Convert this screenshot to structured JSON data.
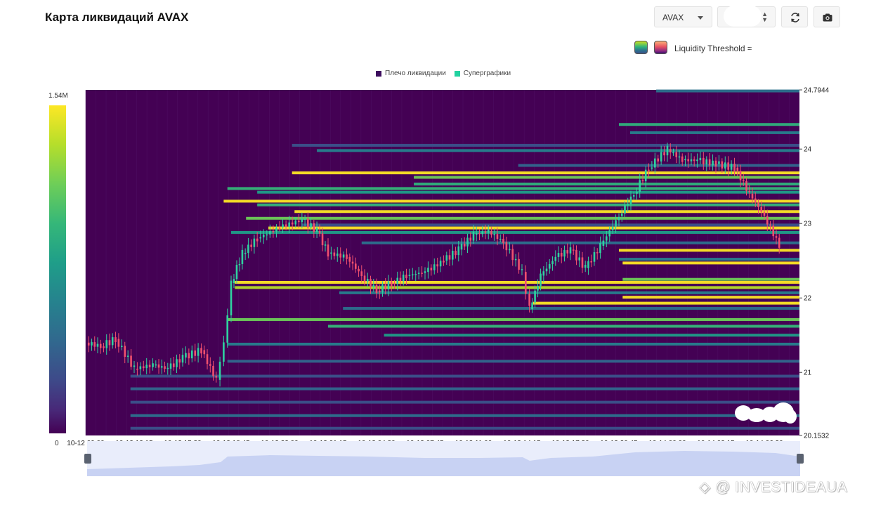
{
  "header": {
    "title": "Карта ликвидаций AVAX",
    "symbol_select": "AVAX",
    "threshold_label": "Liquidity Threshold ="
  },
  "legend": {
    "items": [
      {
        "label": "Плечо ликвидации",
        "color": "#3d0d5e"
      },
      {
        "label": "Суперграфики",
        "color": "#22d2a0"
      }
    ]
  },
  "colorbar": {
    "max_label": "1.54M",
    "min_label": "0"
  },
  "watermark": "◈ @ INVESTIDEAUA",
  "chart_data": {
    "type": "heatmap",
    "title": "Карта ликвидаций AVAX",
    "ylim": [
      20.1532,
      24.7944
    ],
    "y_ticks": [
      "24.7944",
      "24",
      "23",
      "22",
      "21",
      "20.1532"
    ],
    "x_ticks": [
      "10-12 09:00",
      "10-12 12:15",
      "10-12 15:30",
      "10-12 18:45",
      "10-12 22:00",
      "10-13 01:15",
      "10-13 04:30",
      "10-13 07:45",
      "10-13 11:00",
      "10-13 14:15",
      "10-13 17:30",
      "10-13 20:45",
      "10-14 00:00",
      "10-14 03:15",
      "10-14 06:30"
    ],
    "background_color": "#440154",
    "price_line": [
      [
        "10-12 09:00",
        21.4
      ],
      [
        "10-12 10:00",
        21.35
      ],
      [
        "10-12 11:00",
        21.45
      ],
      [
        "10-12 12:15",
        21.05
      ],
      [
        "10-12 13:30",
        21.1
      ],
      [
        "10-12 14:30",
        21.05
      ],
      [
        "10-12 15:30",
        21.2
      ],
      [
        "10-12 16:45",
        21.3
      ],
      [
        "10-12 17:45",
        20.9
      ],
      [
        "10-12 18:15",
        21.4
      ],
      [
        "10-12 18:45",
        22.2
      ],
      [
        "10-12 19:30",
        22.6
      ],
      [
        "10-12 20:30",
        22.8
      ],
      [
        "10-12 22:00",
        22.95
      ],
      [
        "10-12 23:30",
        23.05
      ],
      [
        "10-13 00:30",
        22.9
      ],
      [
        "10-13 01:15",
        22.6
      ],
      [
        "10-13 02:30",
        22.55
      ],
      [
        "10-13 03:30",
        22.3
      ],
      [
        "10-13 04:30",
        22.1
      ],
      [
        "10-13 05:30",
        22.2
      ],
      [
        "10-13 06:30",
        22.3
      ],
      [
        "10-13 07:45",
        22.35
      ],
      [
        "10-13 09:00",
        22.5
      ],
      [
        "10-13 10:00",
        22.65
      ],
      [
        "10-13 11:00",
        22.85
      ],
      [
        "10-13 12:00",
        22.9
      ],
      [
        "10-13 13:00",
        22.75
      ],
      [
        "10-13 14:15",
        22.35
      ],
      [
        "10-13 14:45",
        21.85
      ],
      [
        "10-13 15:30",
        22.3
      ],
      [
        "10-13 16:30",
        22.55
      ],
      [
        "10-13 17:30",
        22.65
      ],
      [
        "10-13 18:30",
        22.4
      ],
      [
        "10-13 19:30",
        22.7
      ],
      [
        "10-13 20:45",
        23.1
      ],
      [
        "10-13 21:45",
        23.4
      ],
      [
        "10-13 22:45",
        23.75
      ],
      [
        "10-14 00:00",
        24.0
      ],
      [
        "10-14 01:00",
        23.85
      ],
      [
        "10-14 02:00",
        23.85
      ],
      [
        "10-14 03:15",
        23.8
      ],
      [
        "10-14 04:30",
        23.75
      ],
      [
        "10-14 05:30",
        23.4
      ],
      [
        "10-14 06:30",
        23.1
      ],
      [
        "10-14 07:30",
        22.7
      ]
    ],
    "bands": [
      {
        "price": 24.78,
        "x_start": "10-13 23:15",
        "color": "#2c728e"
      },
      {
        "price": 24.33,
        "x_start": "10-13 20:45",
        "color": "#2fb47c"
      },
      {
        "price": 24.22,
        "x_start": "10-13 21:30",
        "color": "#26828e"
      },
      {
        "price": 24.05,
        "x_start": "10-12 22:50",
        "color": "#3b528b"
      },
      {
        "price": 23.98,
        "x_start": "10-13 00:30",
        "color": "#26828e"
      },
      {
        "price": 23.78,
        "x_start": "10-13 14:00",
        "color": "#31688e"
      },
      {
        "price": 23.68,
        "x_start": "10-12 22:50",
        "color": "#fde725"
      },
      {
        "price": 23.62,
        "x_start": "10-13 07:00",
        "color": "#6ece58"
      },
      {
        "price": 23.53,
        "x_start": "10-13 07:00",
        "color": "#2fb47c"
      },
      {
        "price": 23.47,
        "x_start": "10-12 18:30",
        "color": "#35b779"
      },
      {
        "price": 23.42,
        "x_start": "10-12 20:30",
        "color": "#1f9e89"
      },
      {
        "price": 23.3,
        "x_start": "10-12 18:15",
        "color": "#fde725"
      },
      {
        "price": 23.25,
        "x_start": "10-12 20:30",
        "color": "#35b779"
      },
      {
        "price": 23.16,
        "x_start": "10-12 23:00",
        "color": "#fde725"
      },
      {
        "price": 23.07,
        "x_start": "10-12 19:45",
        "color": "#6ece58"
      },
      {
        "price": 22.98,
        "x_start": "10-12 23:30",
        "color": "#3b528b"
      },
      {
        "price": 22.94,
        "x_start": "10-12 21:15",
        "color": "#fde725"
      },
      {
        "price": 22.88,
        "x_start": "10-12 18:45",
        "color": "#1f9e89"
      },
      {
        "price": 22.74,
        "x_start": "10-13 03:30",
        "color": "#2c728e"
      },
      {
        "price": 22.64,
        "x_start": "10-13 20:45",
        "color": "#fde725"
      },
      {
        "price": 22.52,
        "x_start": "10-13 20:45",
        "color": "#26828e"
      },
      {
        "price": 22.47,
        "x_start": "10-13 21:00",
        "color": "#fde725"
      },
      {
        "price": 22.25,
        "x_start": "10-13 21:00",
        "color": "#6ece58"
      },
      {
        "price": 22.21,
        "x_start": "10-12 19:00",
        "color": "#fde725"
      },
      {
        "price": 22.14,
        "x_start": "10-12 19:00",
        "color": "#b5de2b"
      },
      {
        "price": 22.07,
        "x_start": "10-13 02:00",
        "color": "#26828e"
      },
      {
        "price": 22.01,
        "x_start": "10-13 21:00",
        "color": "#fde725"
      },
      {
        "price": 21.93,
        "x_start": "10-13 15:00",
        "color": "#fde725"
      },
      {
        "price": 21.86,
        "x_start": "10-13 02:15",
        "color": "#2c728e"
      },
      {
        "price": 21.71,
        "x_start": "10-12 18:30",
        "color": "#6ece58"
      },
      {
        "price": 21.62,
        "x_start": "10-13 01:15",
        "color": "#35b779"
      },
      {
        "price": 21.5,
        "x_start": "10-13 05:00",
        "color": "#1f9e89"
      },
      {
        "price": 21.38,
        "x_start": "10-12 18:30",
        "color": "#26828e"
      },
      {
        "price": 21.15,
        "x_start": "10-12 18:30",
        "color": "#31688e"
      },
      {
        "price": 20.95,
        "x_start": "10-12 12:00",
        "color": "#3b528b"
      },
      {
        "price": 20.78,
        "x_start": "10-12 12:00",
        "color": "#31688e"
      },
      {
        "price": 20.6,
        "x_start": "10-12 12:00",
        "color": "#3b528b"
      },
      {
        "price": 20.42,
        "x_start": "10-12 12:00",
        "color": "#2c728e"
      },
      {
        "price": 20.25,
        "x_start": "10-12 12:00",
        "color": "#3b528b"
      }
    ]
  }
}
